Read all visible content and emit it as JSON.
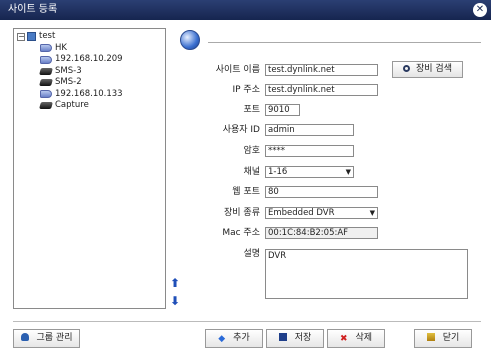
{
  "window": {
    "title": "사이트 등록",
    "close_symbol": "✕"
  },
  "tree": {
    "root": {
      "label": "test",
      "expander": "−"
    },
    "items": [
      {
        "label": "HK",
        "icon": "camera-icon"
      },
      {
        "label": "192.168.10.209",
        "icon": "camera-icon"
      },
      {
        "label": "SMS-3",
        "icon": "dvr-icon"
      },
      {
        "label": "SMS-2",
        "icon": "dvr-icon"
      },
      {
        "label": "192.168.10.133",
        "icon": "camera-icon"
      },
      {
        "label": "Capture",
        "icon": "dvr-icon"
      }
    ]
  },
  "arrows": {
    "up": "⬆",
    "down": "⬇"
  },
  "form": {
    "site_name": {
      "label": "사이트 이름",
      "value": "test.dynlink.net"
    },
    "ip": {
      "label": "IP 주소",
      "value": "test.dynlink.net"
    },
    "port": {
      "label": "포트",
      "value": "9010"
    },
    "user_id": {
      "label": "사용자 ID",
      "value": "admin"
    },
    "password": {
      "label": "암호",
      "value": "****"
    },
    "channel": {
      "label": "채널",
      "value": "1-16",
      "dropdown_symbol": "▼"
    },
    "web_port": {
      "label": "웹 포트",
      "value": "80"
    },
    "device_type": {
      "label": "장비 종류",
      "value": "Embedded DVR",
      "dropdown_symbol": "▼"
    },
    "mac": {
      "label": "Mac 주소",
      "value": "00:1C:84:B2:05:AF"
    },
    "description": {
      "label": "설명",
      "value": "DVR"
    }
  },
  "search_button": {
    "label": "장비 검색"
  },
  "buttons": {
    "group": {
      "label": "그룹 관리"
    },
    "add": {
      "label": "추가",
      "icon_glyph": "◆"
    },
    "save": {
      "label": "저장"
    },
    "delete": {
      "label": "삭제",
      "icon_glyph": "✖"
    },
    "close": {
      "label": "닫기"
    }
  }
}
